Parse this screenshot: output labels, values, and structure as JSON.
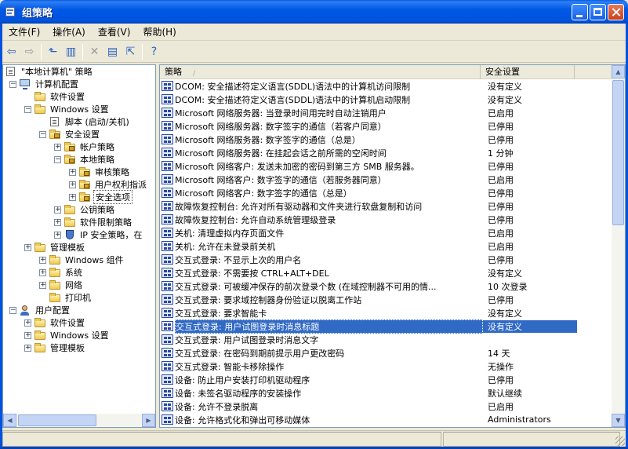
{
  "window": {
    "title": "组策略"
  },
  "menu": [
    "文件(F)",
    "操作(A)",
    "查看(V)",
    "帮助(H)"
  ],
  "tree": {
    "root": "\"本地计算机\" 策略",
    "items": [
      {
        "label": "计算机配置",
        "level": 1,
        "expander": "−",
        "icon": "computer"
      },
      {
        "label": "软件设置",
        "level": 2,
        "expander": "",
        "icon": "folder"
      },
      {
        "label": "Windows 设置",
        "level": 2,
        "expander": "−",
        "icon": "folder"
      },
      {
        "label": "脚本 (启动/关机)",
        "level": 3,
        "expander": "",
        "icon": "doc"
      },
      {
        "label": "安全设置",
        "level": 3,
        "expander": "−",
        "icon": "lock-folder"
      },
      {
        "label": "帐户策略",
        "level": 4,
        "expander": "+",
        "icon": "lock-folder"
      },
      {
        "label": "本地策略",
        "level": 4,
        "expander": "−",
        "icon": "lock-folder"
      },
      {
        "label": "审核策略",
        "level": 5,
        "expander": "+",
        "icon": "lock-folder"
      },
      {
        "label": "用户权利指派",
        "level": 5,
        "expander": "+",
        "icon": "lock-folder"
      },
      {
        "label": "安全选项",
        "level": 5,
        "expander": "+",
        "icon": "lock-folder",
        "selected": true
      },
      {
        "label": "公钥策略",
        "level": 4,
        "expander": "+",
        "icon": "folder"
      },
      {
        "label": "软件限制策略",
        "level": 4,
        "expander": "+",
        "icon": "folder"
      },
      {
        "label": "IP 安全策略，在",
        "level": 4,
        "expander": "+",
        "icon": "shield"
      },
      {
        "label": "管理模板",
        "level": 2,
        "expander": "+",
        "icon": "folder"
      },
      {
        "label": "Windows 组件",
        "level": 3,
        "expander": "+",
        "icon": "folder"
      },
      {
        "label": "系统",
        "level": 3,
        "expander": "+",
        "icon": "folder"
      },
      {
        "label": "网络",
        "level": 3,
        "expander": "+",
        "icon": "folder"
      },
      {
        "label": "打印机",
        "level": 3,
        "expander": "",
        "icon": "folder"
      },
      {
        "label": "用户配置",
        "level": 1,
        "expander": "−",
        "icon": "user"
      },
      {
        "label": "软件设置",
        "level": 2,
        "expander": "+",
        "icon": "folder"
      },
      {
        "label": "Windows 设置",
        "level": 2,
        "expander": "+",
        "icon": "folder"
      },
      {
        "label": "管理模板",
        "level": 2,
        "expander": "+",
        "icon": "folder"
      }
    ]
  },
  "list": {
    "columns": [
      "策略",
      "安全设置"
    ],
    "rows": [
      {
        "policy": "DCOM: 安全描述符定义语言(SDDL)语法中的计算机访问限制",
        "setting": "没有定义"
      },
      {
        "policy": "DCOM: 安全描述符定义语言(SDDL)语法中的计算机启动限制",
        "setting": "没有定义"
      },
      {
        "policy": "Microsoft 网络服务器: 当登录时间用完时自动注销用户",
        "setting": "已启用"
      },
      {
        "policy": "Microsoft 网络服务器: 数字签字的通信（若客户同意）",
        "setting": "已停用"
      },
      {
        "policy": "Microsoft 网络服务器: 数字签字的通信（总是）",
        "setting": "已停用"
      },
      {
        "policy": "Microsoft 网络服务器: 在挂起会话之前所需的空闲时间",
        "setting": "1 分钟"
      },
      {
        "policy": "Microsoft 网络客户: 发送未加密的密码到第三方 SMB 服务器。",
        "setting": "已停用"
      },
      {
        "policy": "Microsoft 网络客户: 数字签字的通信（若服务器同意）",
        "setting": "已启用"
      },
      {
        "policy": "Microsoft 网络客户: 数字签字的通信（总是）",
        "setting": "已停用"
      },
      {
        "policy": "故障恢复控制台: 允许对所有驱动器和文件夹进行软盘复制和访问",
        "setting": "已停用"
      },
      {
        "policy": "故障恢复控制台: 允许自动系统管理级登录",
        "setting": "已停用"
      },
      {
        "policy": "关机: 清理虚拟内存页面文件",
        "setting": "已启用"
      },
      {
        "policy": "关机: 允许在未登录前关机",
        "setting": "已启用"
      },
      {
        "policy": "交互式登录: 不显示上次的用户名",
        "setting": "已停用"
      },
      {
        "policy": "交互式登录: 不需要按 CTRL+ALT+DEL",
        "setting": "没有定义"
      },
      {
        "policy": "交互式登录: 可被缓冲保存的前次登录个数 (在域控制器不可用的情...",
        "setting": "10 次登录"
      },
      {
        "policy": "交互式登录: 要求域控制器身份验证以脱离工作站",
        "setting": "已停用"
      },
      {
        "policy": "交互式登录: 要求智能卡",
        "setting": "没有定义"
      },
      {
        "policy": "交互式登录: 用户试图登录时消息标题",
        "setting": "没有定义",
        "selected": true
      },
      {
        "policy": "交互式登录: 用户试图登录时消息文字",
        "setting": ""
      },
      {
        "policy": "交互式登录: 在密码到期前提示用户更改密码",
        "setting": "14 天"
      },
      {
        "policy": "交互式登录: 智能卡移除操作",
        "setting": "无操作"
      },
      {
        "policy": "设备: 防止用户安装打印机驱动程序",
        "setting": "已停用"
      },
      {
        "policy": "设备: 未签名驱动程序的安装操作",
        "setting": "默认继续"
      },
      {
        "policy": "设备: 允许不登录脱离",
        "setting": "已启用"
      },
      {
        "policy": "设备: 允许格式化和弹出可移动媒体",
        "setting": "Administrators"
      }
    ]
  },
  "colors": {
    "titlebar": "#0053dd",
    "selection": "#316ac5",
    "chrome": "#ece9d8"
  }
}
